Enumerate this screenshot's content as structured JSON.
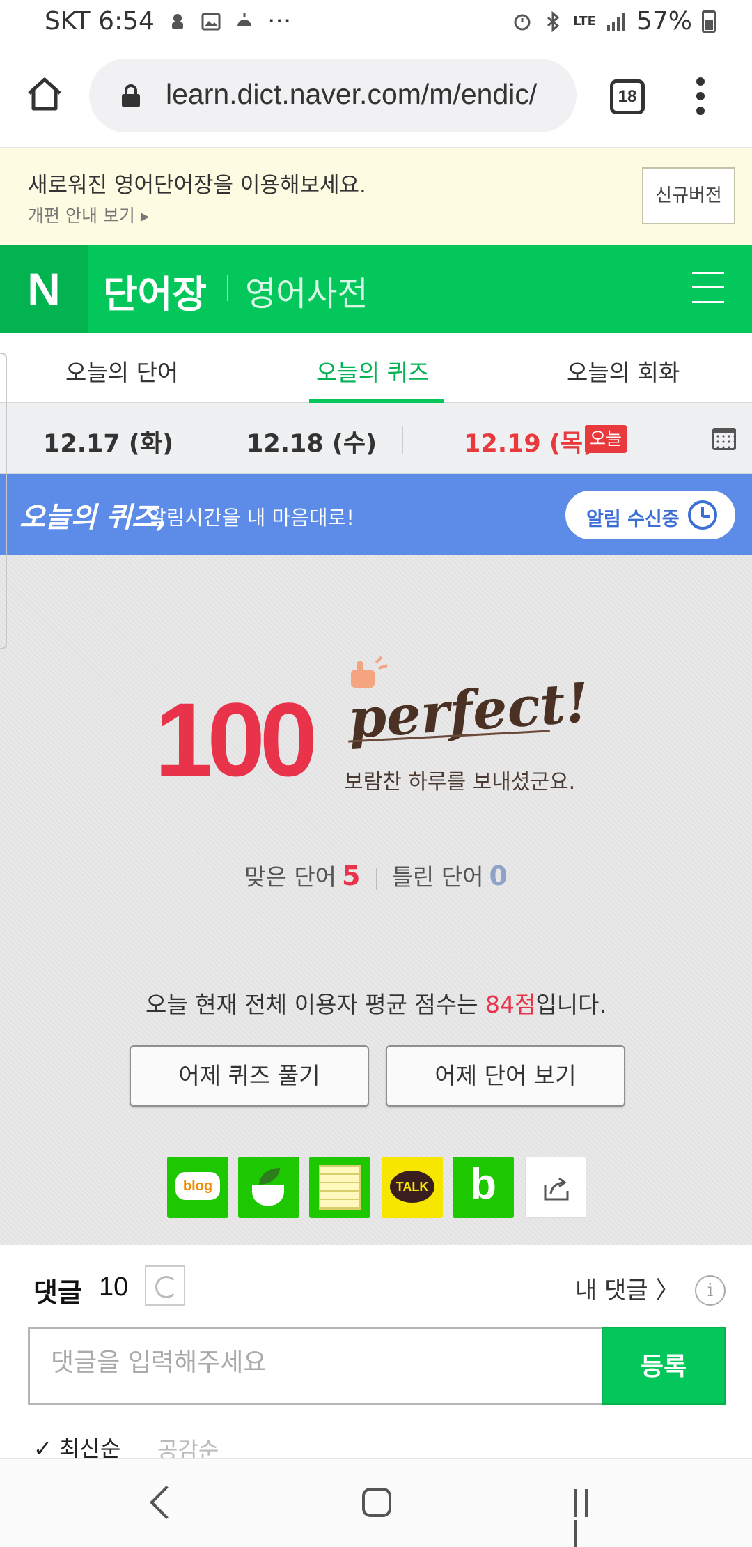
{
  "status_bar": {
    "carrier_time": "SKT 6:54",
    "dots": "···",
    "network": "LTE",
    "battery": "57%"
  },
  "browser": {
    "url": "learn.dict.naver.com/m/endic/",
    "tab_count": "18"
  },
  "notice": {
    "title": "새로워진 영어단어장을 이용해보세요.",
    "link": "개편 안내 보기 ▸",
    "new_version_button": "신규버전"
  },
  "header": {
    "logo": "N",
    "title": "단어장",
    "subtitle": "영어사전"
  },
  "tabs": [
    {
      "label": "오늘의 단어"
    },
    {
      "label": "오늘의 퀴즈",
      "active": true
    },
    {
      "label": "오늘의 회화"
    }
  ],
  "dates": [
    {
      "label": "12.17 (화)"
    },
    {
      "label": "12.18 (수)"
    },
    {
      "label": "12.19 (목)",
      "today": true
    }
  ],
  "today_badge": "오늘",
  "quiz_banner": {
    "brand": "오늘의 퀴즈,",
    "description": "알림시간을 내 마음대로!",
    "alarm_button": "알림 수신중"
  },
  "result": {
    "score": "100",
    "perfect_text": "perfect!",
    "message": "보람찬 하루를 보내셨군요.",
    "correct_label": "맞은 단어",
    "correct_count": "5",
    "wrong_label": "틀린 단어",
    "wrong_count": "0",
    "average_prefix": "오늘 현재 전체 이용자 평균 점수는 ",
    "average_points": "84점",
    "average_suffix": "입니다.",
    "buttons": {
      "yesterday_quiz": "어제 퀴즈 풀기",
      "yesterday_words": "어제 단어 보기"
    }
  },
  "share": {
    "blog_label": "blog",
    "talk_label": "TALK",
    "band_label": "b"
  },
  "comments": {
    "title": "댓글",
    "count": "10",
    "my_comments": "내 댓글 〉",
    "info": "i",
    "placeholder": "댓글을 입력해주세요",
    "submit": "등록",
    "sort_latest": "✓ 최신순",
    "sort_likes": "공감순"
  },
  "colors": {
    "naver_green": "#03c75a",
    "score_red": "#e8334b",
    "banner_blue": "#5d8ce8",
    "notice_bg": "#fdfbe2"
  }
}
